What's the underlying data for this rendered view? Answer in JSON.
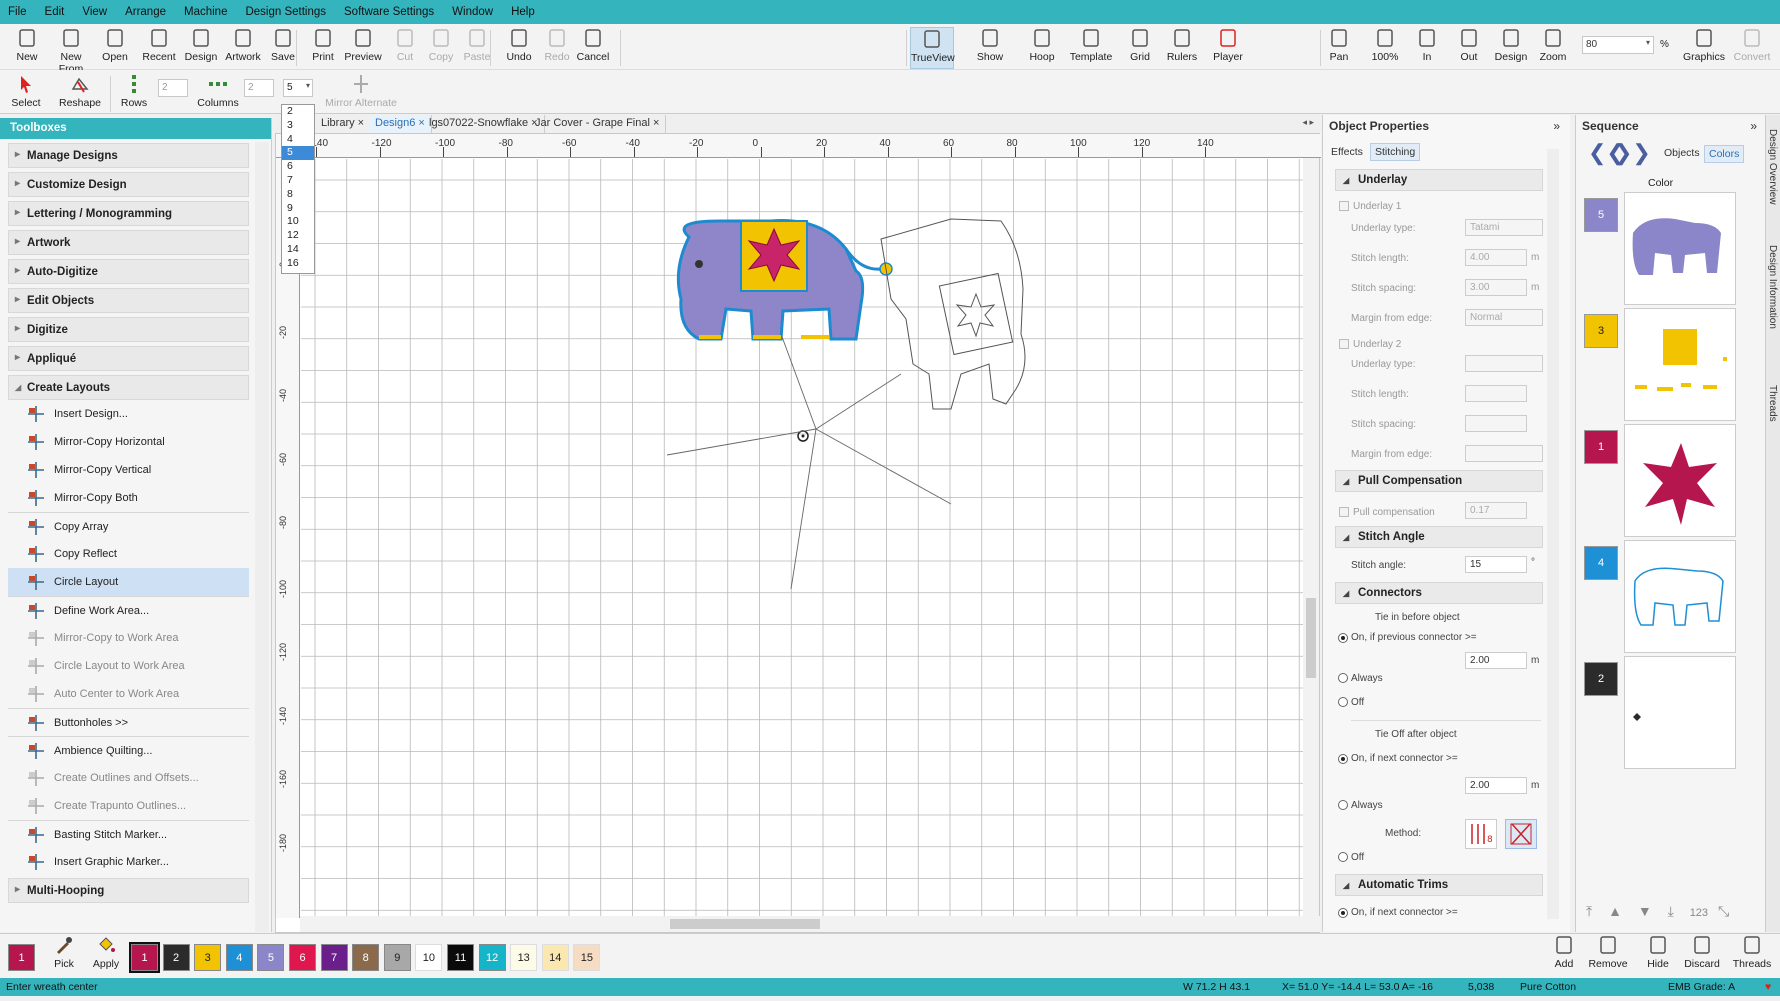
{
  "menu": [
    "File",
    "Edit",
    "View",
    "Arrange",
    "Machine",
    "Design Settings",
    "Software Settings",
    "Window",
    "Help"
  ],
  "toolbar1": {
    "left": [
      {
        "label": "New",
        "icon": "new-file-icon"
      },
      {
        "label": "New From",
        "icon": "new-from-icon"
      },
      {
        "label": "Open",
        "icon": "open-folder-icon"
      },
      {
        "label": "Recent",
        "icon": "recent-icon"
      },
      {
        "label": "Design",
        "icon": "design-icon"
      },
      {
        "label": "Artwork",
        "icon": "artwork-icon"
      },
      {
        "label": "Save",
        "icon": "save-icon"
      },
      {
        "label": "Print",
        "icon": "print-icon"
      },
      {
        "label": "Preview",
        "icon": "preview-icon"
      },
      {
        "label": "Cut",
        "icon": "cut-icon"
      },
      {
        "label": "Copy",
        "icon": "copy-icon"
      },
      {
        "label": "Paste",
        "icon": "paste-icon"
      },
      {
        "label": "Undo",
        "icon": "undo-icon"
      },
      {
        "label": "Redo",
        "icon": "redo-icon"
      },
      {
        "label": "Cancel",
        "icon": "esc-icon"
      }
    ],
    "mid": [
      {
        "label": "TrueView",
        "icon": "trueview-icon"
      },
      {
        "label": "Show",
        "icon": "show-icon"
      },
      {
        "label": "Hoop",
        "icon": "hoop-icon"
      },
      {
        "label": "Template",
        "icon": "template-icon"
      },
      {
        "label": "Grid",
        "icon": "grid-icon"
      },
      {
        "label": "Rulers",
        "icon": "rulers-icon"
      },
      {
        "label": "Player",
        "icon": "player-icon"
      }
    ],
    "right": [
      {
        "label": "Pan",
        "icon": "pan-icon"
      },
      {
        "label": "100%",
        "icon": "zoom-100-icon"
      },
      {
        "label": "In",
        "icon": "zoom-in-icon"
      },
      {
        "label": "Out",
        "icon": "zoom-out-icon"
      },
      {
        "label": "Design",
        "icon": "zoom-design-icon"
      },
      {
        "label": "Zoom",
        "icon": "zoom-icon"
      }
    ],
    "zoom_value": "80",
    "zoom_unit": "%",
    "far_right": [
      {
        "label": "Graphics",
        "icon": "graphics-icon"
      },
      {
        "label": "Convert",
        "icon": "convert-icon"
      }
    ]
  },
  "toolbar2": {
    "select": "Select",
    "reshape": "Reshape",
    "rows": "Rows",
    "rows_value": "2",
    "columns": "Columns",
    "columns_value": "2",
    "count_value": "5",
    "mirror_alternate": "Mirror Alternate"
  },
  "count_options": [
    "2",
    "3",
    "4",
    "5",
    "6",
    "7",
    "8",
    "9",
    "10",
    "12",
    "14",
    "16"
  ],
  "count_selected": "5",
  "toolboxes": {
    "title": "Toolboxes",
    "sections": [
      "Manage Designs",
      "Customize Design",
      "Lettering / Monogramming",
      "Artwork",
      "Auto-Digitize",
      "Edit Objects",
      "Digitize",
      "Appliqué"
    ],
    "open_section": "Create Layouts",
    "items": [
      {
        "label": "Insert Design...",
        "icon": "insert-design-icon",
        "dim": false
      },
      {
        "label": "Mirror-Copy Horizontal",
        "icon": "mirror-horizontal-icon",
        "dim": false
      },
      {
        "label": "Mirror-Copy Vertical",
        "icon": "mirror-vertical-icon",
        "dim": false
      },
      {
        "label": "Mirror-Copy Both",
        "icon": "mirror-both-icon",
        "dim": false
      },
      {
        "label": "Copy Array",
        "icon": "copy-array-icon",
        "dim": false
      },
      {
        "label": "Copy Reflect",
        "icon": "copy-reflect-icon",
        "dim": false
      },
      {
        "label": "Circle Layout",
        "icon": "circle-layout-icon",
        "dim": false
      },
      {
        "label": "Define Work Area...",
        "icon": "work-area-icon",
        "dim": false
      },
      {
        "label": "Mirror-Copy to Work Area",
        "icon": "mirror-work-area-icon",
        "dim": true
      },
      {
        "label": "Circle Layout to Work Area",
        "icon": "circle-work-area-icon",
        "dim": true
      },
      {
        "label": "Auto Center to Work Area",
        "icon": "auto-center-icon",
        "dim": true
      },
      {
        "label": "Buttonholes >>",
        "icon": "buttonholes-icon",
        "dim": false
      },
      {
        "label": "Ambience Quilting...",
        "icon": "quilting-icon",
        "dim": false
      },
      {
        "label": "Create Outlines and Offsets...",
        "icon": "outlines-icon",
        "dim": true
      },
      {
        "label": "Create Trapunto Outlines...",
        "icon": "trapunto-icon",
        "dim": true
      },
      {
        "label": "Basting Stitch Marker...",
        "icon": "basting-icon",
        "dim": false
      },
      {
        "label": "Insert Graphic Marker...",
        "icon": "graphic-marker-icon",
        "dim": false
      }
    ],
    "bottom_section": "Multi-Hooping"
  },
  "tabs": [
    "Library",
    "Design6",
    "lgs07022-Snowflake",
    "Jar Cover - Grape Final"
  ],
  "active_tab": "Design6",
  "ruler": {
    "top": [
      "-140",
      "-120",
      "-100",
      "-80",
      "-60",
      "-40",
      "-20",
      "0",
      "20",
      "40",
      "60",
      "80",
      "100",
      "120",
      "140"
    ],
    "left": [
      "0",
      "-20",
      "-40",
      "-60",
      "-80",
      "-100",
      "-120",
      "-140",
      "-160",
      "-180"
    ]
  },
  "object_properties": {
    "title": "Object Properties",
    "tabs": [
      "Effects",
      "Stitching"
    ],
    "active_tab": "Stitching",
    "underlay": {
      "title": "Underlay",
      "u1_label": "Underlay 1",
      "type_label": "Underlay type:",
      "type_value": "Tatami",
      "stitch_length_label": "Stitch length:",
      "stitch_length_value": "4.00",
      "stitch_spacing_label": "Stitch spacing:",
      "stitch_spacing_value": "3.00",
      "margin_label": "Margin from edge:",
      "margin_value": "Normal",
      "u2_label": "Underlay 2",
      "unit": "m"
    },
    "pull": {
      "title": "Pull Compensation",
      "label": "Pull compensation",
      "value": "0.17"
    },
    "angle": {
      "title": "Stitch Angle",
      "label": "Stitch angle:",
      "value": "15",
      "unit": "°"
    },
    "connectors": {
      "title": "Connectors",
      "tie_in": "Tie in before object",
      "on_prev": "On, if previous connector >=",
      "on_prev_value": "2.00",
      "always": "Always",
      "off": "Off",
      "tie_off": "Tie Off after object",
      "on_next": "On, if next connector >=",
      "on_next_value": "2.00",
      "method": "Method:"
    },
    "trims": {
      "title": "Automatic Trims",
      "on_next": "On, if next connector >="
    }
  },
  "sequence": {
    "title": "Sequence",
    "tabs": [
      "Objects",
      "Colors"
    ],
    "active_tab": "Colors",
    "color_label": "Color",
    "items": [
      {
        "num": "5",
        "color": "#8a86c9",
        "text_color": "#ffffff"
      },
      {
        "num": "3",
        "color": "#f2c300",
        "text_color": "#222222"
      },
      {
        "num": "1",
        "color": "#b5164e",
        "text_color": "#ffffff"
      },
      {
        "num": "4",
        "color": "#1e90d6",
        "text_color": "#ffffff"
      },
      {
        "num": "2",
        "color": "#2b2b2b",
        "text_color": "#ffffff"
      }
    ],
    "side_tabs": [
      "Design Overview",
      "Design Information",
      "Threads"
    ]
  },
  "palette": {
    "pick": "Pick",
    "apply": "Apply",
    "colors": [
      {
        "num": "1",
        "color": "#b5164e",
        "text_color": "#ffffff"
      },
      {
        "num": "2",
        "color": "#2b2b2b",
        "text_color": "#ffffff"
      },
      {
        "num": "3",
        "color": "#f2c300",
        "text_color": "#222222"
      },
      {
        "num": "4",
        "color": "#1e90d6",
        "text_color": "#ffffff"
      },
      {
        "num": "5",
        "color": "#8a86c9",
        "text_color": "#ffffff"
      },
      {
        "num": "6",
        "color": "#e0164e",
        "text_color": "#ffffff"
      },
      {
        "num": "7",
        "color": "#6a1f8a",
        "text_color": "#ffffff"
      },
      {
        "num": "8",
        "color": "#8a6a4a",
        "text_color": "#ffffff"
      },
      {
        "num": "9",
        "color": "#a8a8a8",
        "text_color": "#222222"
      },
      {
        "num": "10",
        "color": "#ffffff",
        "text_color": "#222222"
      },
      {
        "num": "11",
        "color": "#0a0a0a",
        "text_color": "#ffffff"
      },
      {
        "num": "12",
        "color": "#16b4c8",
        "text_color": "#ffffff"
      },
      {
        "num": "13",
        "color": "#fbfbe8",
        "text_color": "#222222"
      },
      {
        "num": "14",
        "color": "#fbe7b0",
        "text_color": "#222222"
      },
      {
        "num": "15",
        "color": "#f7dcc4",
        "text_color": "#222222"
      }
    ],
    "right": [
      {
        "label": "Add",
        "icon": "add-icon"
      },
      {
        "label": "Remove",
        "icon": "remove-icon"
      },
      {
        "label": "Hide",
        "icon": "hide-icon"
      },
      {
        "label": "Discard",
        "icon": "discard-icon"
      },
      {
        "label": "Threads",
        "icon": "threads-icon"
      }
    ]
  },
  "status": {
    "hint": "Enter wreath center",
    "size": "W 71.2 H 43.1",
    "coords": "X= 51.0 Y= -14.4 L= 53.0 A= -16",
    "stitches": "5,038",
    "fabric": "Pure Cotton",
    "grade": "EMB Grade: A"
  }
}
